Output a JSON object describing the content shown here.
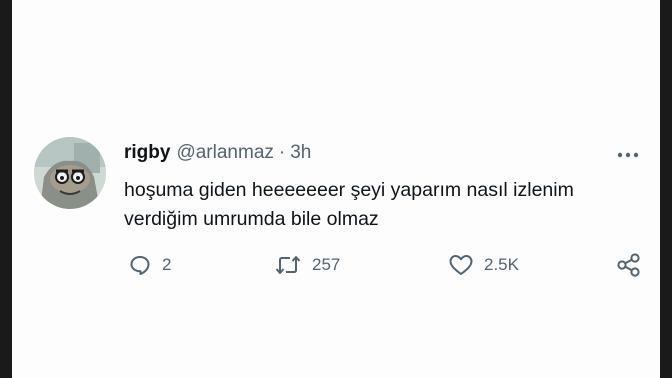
{
  "tweet": {
    "display_name": "rigby",
    "handle": "@arlanmaz",
    "separator": "·",
    "time": "3h",
    "text_lines": [
      "hoşuma giden heeeeeeer şeyi yaparım nasıl izlenim",
      "verdiğim umrumda bile olmaz"
    ],
    "actions": {
      "reply_count": "2",
      "retweet_count": "257",
      "like_count": "2.5K"
    }
  },
  "icons": {
    "avatar": "avatar-image",
    "more": "more-options-icon",
    "reply": "reply-icon",
    "retweet": "retweet-icon",
    "like": "heart-icon",
    "share": "share-icon"
  }
}
